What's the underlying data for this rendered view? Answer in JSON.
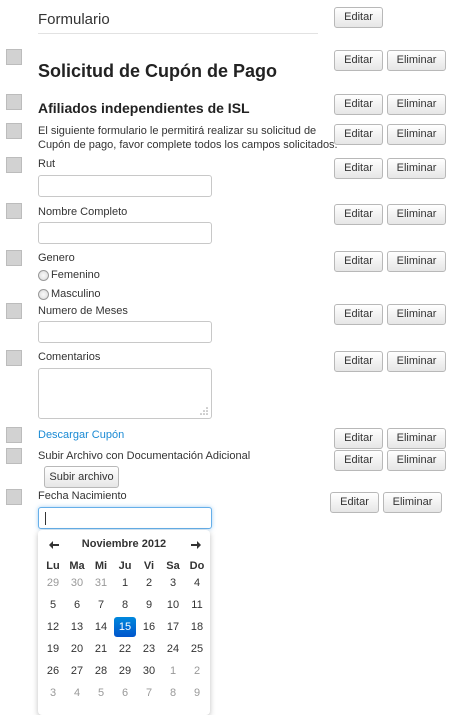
{
  "form": {
    "header": "Formulario",
    "title": "Solicitud de Cupón de Pago",
    "subtitle": "Afiliados independientes de ISL",
    "description_line1": "El siguiente formulario le permitirá realizar su solicitud de",
    "description_line2": "Cupón de pago, favor complete todos los campos solicitados.",
    "rut_label": "Rut",
    "nombre_label": "Nombre Completo",
    "genero_label": "Genero",
    "genero_options": [
      "Femenino",
      "Masculino"
    ],
    "meses_label": "Numero de Meses",
    "comentarios_label": "Comentarios",
    "descargar_link": "Descargar Cupón",
    "subir_label": "Subir Archivo con Documentación Adicional",
    "subir_button": "Subir archivo",
    "fecha_label": "Fecha Nacimiento"
  },
  "actions": {
    "edit_label": "Editar",
    "delete_label": "Eliminar"
  },
  "calendar": {
    "prev_icon": "arrow-left-icon",
    "next_icon": "arrow-right-icon",
    "month_year": "Noviembre 2012",
    "weekdays": [
      "Lu",
      "Ma",
      "Mi",
      "Ju",
      "Vi",
      "Sa",
      "Do"
    ],
    "weeks": [
      [
        "29",
        "30",
        "31",
        "1",
        "2",
        "3",
        "4"
      ],
      [
        "5",
        "6",
        "7",
        "8",
        "9",
        "10",
        "11"
      ],
      [
        "12",
        "13",
        "14",
        "15",
        "16",
        "17",
        "18"
      ],
      [
        "19",
        "20",
        "21",
        "22",
        "23",
        "24",
        "25"
      ],
      [
        "26",
        "27",
        "28",
        "29",
        "30",
        "1",
        "2"
      ],
      [
        "3",
        "4",
        "5",
        "6",
        "7",
        "8",
        "9"
      ]
    ],
    "selected_day": "15",
    "accent": "#0066cc"
  },
  "colors": {
    "link": "#1a8ad4",
    "focus_border": "#66afe9"
  }
}
